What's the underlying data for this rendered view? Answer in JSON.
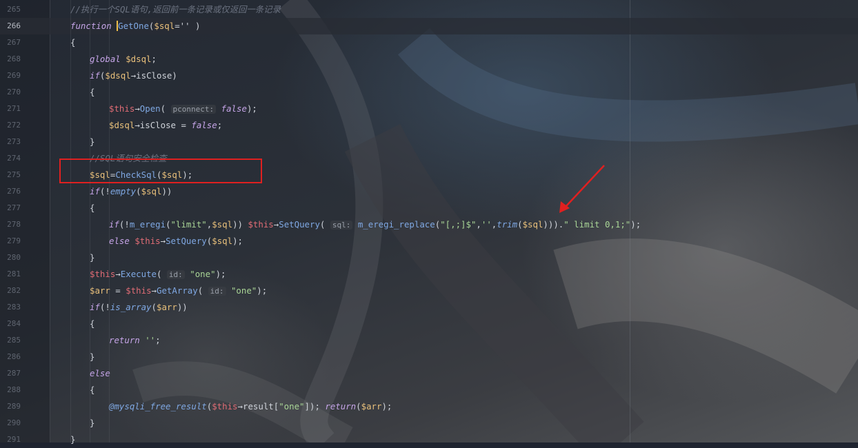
{
  "editor": {
    "lines": [
      {
        "n": "265",
        "indent": 1,
        "tokens": [
          [
            "cmt",
            "//执行一个SQL语句,返回前一条记录或仅返回一条记录"
          ]
        ]
      },
      {
        "n": "266",
        "indent": 1,
        "current": true,
        "tokens": [
          [
            "kw",
            "function "
          ],
          [
            "caret",
            ""
          ],
          [
            "fn",
            "GetOne"
          ],
          [
            "p",
            "("
          ],
          [
            "var",
            "$sql"
          ],
          [
            "p",
            "='' )"
          ]
        ]
      },
      {
        "n": "267",
        "indent": 1,
        "tokens": [
          [
            "p",
            "{"
          ]
        ]
      },
      {
        "n": "268",
        "indent": 2,
        "tokens": [
          [
            "kw",
            "global "
          ],
          [
            "var",
            "$dsql"
          ],
          [
            "p",
            ";"
          ]
        ]
      },
      {
        "n": "269",
        "indent": 2,
        "tokens": [
          [
            "kw",
            "if"
          ],
          [
            "p",
            "("
          ],
          [
            "var",
            "$dsql"
          ],
          [
            "arr",
            "→"
          ],
          [
            "p",
            "isClose)"
          ]
        ]
      },
      {
        "n": "270",
        "indent": 2,
        "tokens": [
          [
            "p",
            "{"
          ]
        ]
      },
      {
        "n": "271",
        "indent": 3,
        "tokens": [
          [
            "this",
            "$this"
          ],
          [
            "arr",
            "→"
          ],
          [
            "fn",
            "Open"
          ],
          [
            "p",
            "( "
          ],
          [
            "hint",
            "pconnect:"
          ],
          [
            "p",
            " "
          ],
          [
            "kw",
            "false"
          ],
          [
            "p",
            ");"
          ]
        ]
      },
      {
        "n": "272",
        "indent": 3,
        "tokens": [
          [
            "var",
            "$dsql"
          ],
          [
            "arr",
            "→"
          ],
          [
            "p",
            "isClose = "
          ],
          [
            "kw",
            "false"
          ],
          [
            "p",
            ";"
          ]
        ]
      },
      {
        "n": "273",
        "indent": 2,
        "tokens": [
          [
            "p",
            "}"
          ]
        ]
      },
      {
        "n": "274",
        "indent": 2,
        "tokens": [
          [
            "cmt",
            "//SQL语句安全检查"
          ]
        ]
      },
      {
        "n": "275",
        "indent": 2,
        "tokens": [
          [
            "var",
            "$sql"
          ],
          [
            "p",
            "="
          ],
          [
            "fn",
            "CheckSql"
          ],
          [
            "p",
            "("
          ],
          [
            "var",
            "$sql"
          ],
          [
            "p",
            ");"
          ]
        ]
      },
      {
        "n": "276",
        "indent": 2,
        "tokens": [
          [
            "kw",
            "if"
          ],
          [
            "p",
            "(!"
          ],
          [
            "ifn",
            "empty"
          ],
          [
            "p",
            "("
          ],
          [
            "var",
            "$sql"
          ],
          [
            "p",
            "))"
          ]
        ]
      },
      {
        "n": "277",
        "indent": 2,
        "tokens": [
          [
            "p",
            "{"
          ]
        ]
      },
      {
        "n": "278",
        "indent": 3,
        "tokens": [
          [
            "kw",
            "if"
          ],
          [
            "p",
            "(!"
          ],
          [
            "fn",
            "m_eregi"
          ],
          [
            "p",
            "("
          ],
          [
            "str",
            "\"limit\""
          ],
          [
            "p",
            ","
          ],
          [
            "var",
            "$sql"
          ],
          [
            "p",
            ")) "
          ],
          [
            "this",
            "$this"
          ],
          [
            "arr",
            "→"
          ],
          [
            "fn",
            "SetQuery"
          ],
          [
            "p",
            "( "
          ],
          [
            "hint",
            "sql:"
          ],
          [
            "p",
            " "
          ],
          [
            "fn",
            "m_eregi_replace"
          ],
          [
            "p",
            "("
          ],
          [
            "str",
            "\"[,;]$\""
          ],
          [
            "p",
            ","
          ],
          [
            "str",
            "''"
          ],
          [
            "p",
            ","
          ],
          [
            "ifn",
            "trim"
          ],
          [
            "p",
            "("
          ],
          [
            "var",
            "$sql"
          ],
          [
            "p",
            ")))."
          ],
          [
            "str",
            "\" limit 0,1;\""
          ],
          [
            "p",
            ");"
          ]
        ]
      },
      {
        "n": "279",
        "indent": 3,
        "tokens": [
          [
            "kw",
            "else "
          ],
          [
            "this",
            "$this"
          ],
          [
            "arr",
            "→"
          ],
          [
            "fn",
            "SetQuery"
          ],
          [
            "p",
            "("
          ],
          [
            "var",
            "$sql"
          ],
          [
            "p",
            ");"
          ]
        ]
      },
      {
        "n": "280",
        "indent": 2,
        "tokens": [
          [
            "p",
            "}"
          ]
        ]
      },
      {
        "n": "281",
        "indent": 2,
        "tokens": [
          [
            "this",
            "$this"
          ],
          [
            "arr",
            "→"
          ],
          [
            "fn",
            "Execute"
          ],
          [
            "p",
            "( "
          ],
          [
            "hint",
            "id:"
          ],
          [
            "p",
            " "
          ],
          [
            "str",
            "\"one\""
          ],
          [
            "p",
            ");"
          ]
        ]
      },
      {
        "n": "282",
        "indent": 2,
        "tokens": [
          [
            "var",
            "$arr"
          ],
          [
            "p",
            " = "
          ],
          [
            "this",
            "$this"
          ],
          [
            "arr",
            "→"
          ],
          [
            "fn",
            "GetArray"
          ],
          [
            "p",
            "( "
          ],
          [
            "hint",
            "id:"
          ],
          [
            "p",
            " "
          ],
          [
            "str",
            "\"one\""
          ],
          [
            "p",
            ");"
          ]
        ]
      },
      {
        "n": "283",
        "indent": 2,
        "tokens": [
          [
            "kw",
            "if"
          ],
          [
            "p",
            "(!"
          ],
          [
            "ifn",
            "is_array"
          ],
          [
            "p",
            "("
          ],
          [
            "var",
            "$arr"
          ],
          [
            "p",
            "))"
          ]
        ]
      },
      {
        "n": "284",
        "indent": 2,
        "tokens": [
          [
            "p",
            "{"
          ]
        ]
      },
      {
        "n": "285",
        "indent": 3,
        "tokens": [
          [
            "kw",
            "return "
          ],
          [
            "str",
            "''"
          ],
          [
            "p",
            ";"
          ]
        ]
      },
      {
        "n": "286",
        "indent": 2,
        "tokens": [
          [
            "p",
            "}"
          ]
        ]
      },
      {
        "n": "287",
        "indent": 2,
        "tokens": [
          [
            "kw",
            "else"
          ]
        ]
      },
      {
        "n": "288",
        "indent": 2,
        "tokens": [
          [
            "p",
            "{"
          ]
        ]
      },
      {
        "n": "289",
        "indent": 3,
        "tokens": [
          [
            "ifn",
            "@mysqli_free_result"
          ],
          [
            "p",
            "("
          ],
          [
            "this",
            "$this"
          ],
          [
            "arr",
            "→"
          ],
          [
            "p",
            "result["
          ],
          [
            "str",
            "\"one\""
          ],
          [
            "p",
            "]); "
          ],
          [
            "kw",
            "return"
          ],
          [
            "p",
            "("
          ],
          [
            "var",
            "$arr"
          ],
          [
            "p",
            ");"
          ]
        ]
      },
      {
        "n": "290",
        "indent": 2,
        "tokens": [
          [
            "p",
            "}"
          ]
        ]
      },
      {
        "n": "291",
        "indent": 1,
        "tokens": [
          [
            "p",
            "}"
          ]
        ]
      }
    ]
  },
  "annotations": {
    "highlight_line": "275",
    "highlight_color": "#e02020",
    "arrow_color": "#e02020"
  }
}
